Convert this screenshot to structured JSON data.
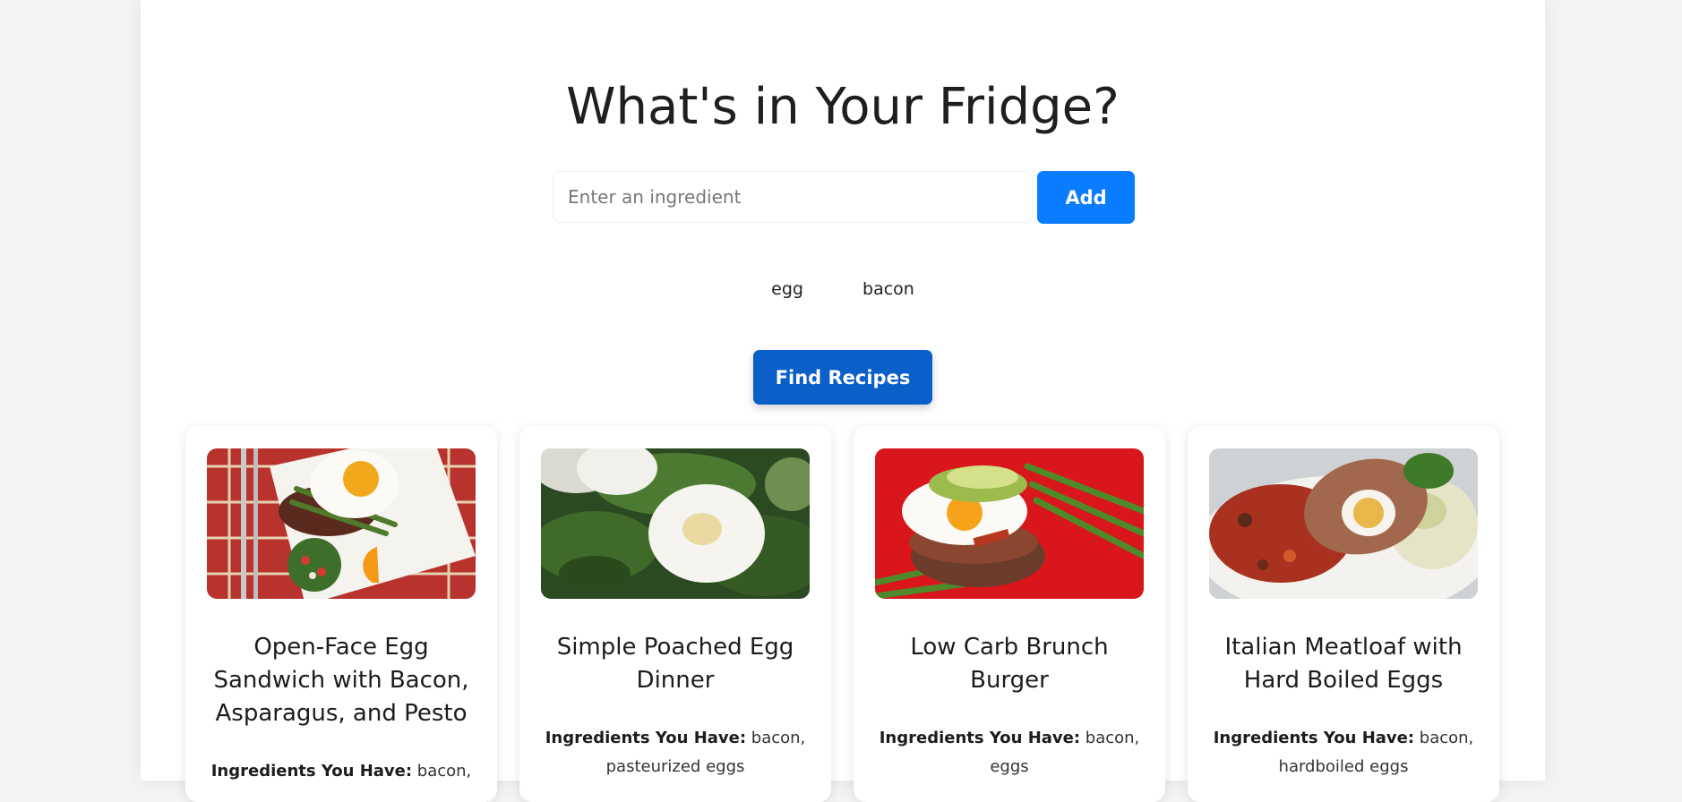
{
  "header": {
    "title": "What's in Your Fridge?"
  },
  "search": {
    "placeholder": "Enter an ingredient",
    "value": "",
    "add_label": "Add"
  },
  "ingredients": [
    "egg",
    "bacon"
  ],
  "find_label": "Find Recipes",
  "recipes": [
    {
      "title": "Open-Face Egg Sandwich with Bacon, Asparagus, and Pesto",
      "have_label": "Ingredients You Have:",
      "have_value": "bacon,",
      "image": "fried-egg-sandwich-photo"
    },
    {
      "title": "Simple Poached Egg Dinner",
      "have_label": "Ingredients You Have:",
      "have_value": "bacon, pasteurized eggs",
      "image": "poached-egg-photo"
    },
    {
      "title": "Low Carb Brunch Burger",
      "have_label": "Ingredients You Have:",
      "have_value": "bacon, eggs",
      "image": "brunch-burger-photo"
    },
    {
      "title": "Italian Meatloaf with Hard Boiled Eggs",
      "have_label": "Ingredients You Have:",
      "have_value": "bacon, hardboiled eggs",
      "image": "meatloaf-photo"
    }
  ],
  "colors": {
    "add_button": "#0a7cff",
    "find_button": "#0a5fc9"
  }
}
